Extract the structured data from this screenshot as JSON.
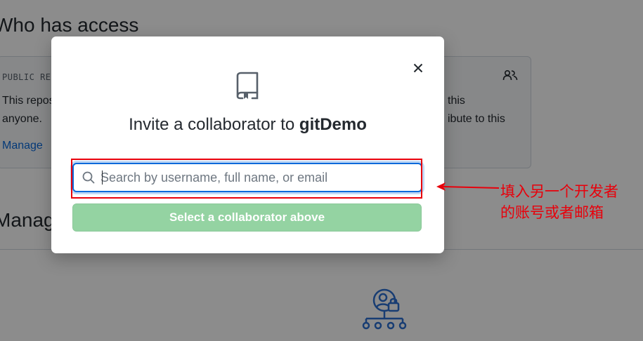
{
  "background": {
    "who_has_access_heading": "Who has access",
    "visibility_label": "PUBLIC REPOSITORY",
    "visibility_text_line1": "This repository is public and visible to anyone.",
    "visibility_text_line2": "anyone.",
    "contrib_text_line1": "this",
    "contrib_text_line2": "ibute to this",
    "manage_link": "Manage",
    "manage_heading": "Manage access"
  },
  "modal": {
    "title_prefix": "Invite a collaborator to ",
    "repo_name": "gitDemo",
    "search_placeholder": "Search by username, full name, or email",
    "select_button_label": "Select a collaborator above",
    "close_symbol": "×"
  },
  "annotation": {
    "line1": "填入另一个开发者",
    "line2": "的账号或者邮箱"
  },
  "colors": {
    "overlay": "rgba(0,0,0,0.45)",
    "accent_blue": "#0969da",
    "disabled_green": "#94d3a2",
    "annotation_red": "#e8000b"
  },
  "icons": {
    "close": "close-icon",
    "repo": "repo-icon",
    "search": "search-icon",
    "people": "people-icon",
    "manage_access": "manage-access-icon"
  }
}
